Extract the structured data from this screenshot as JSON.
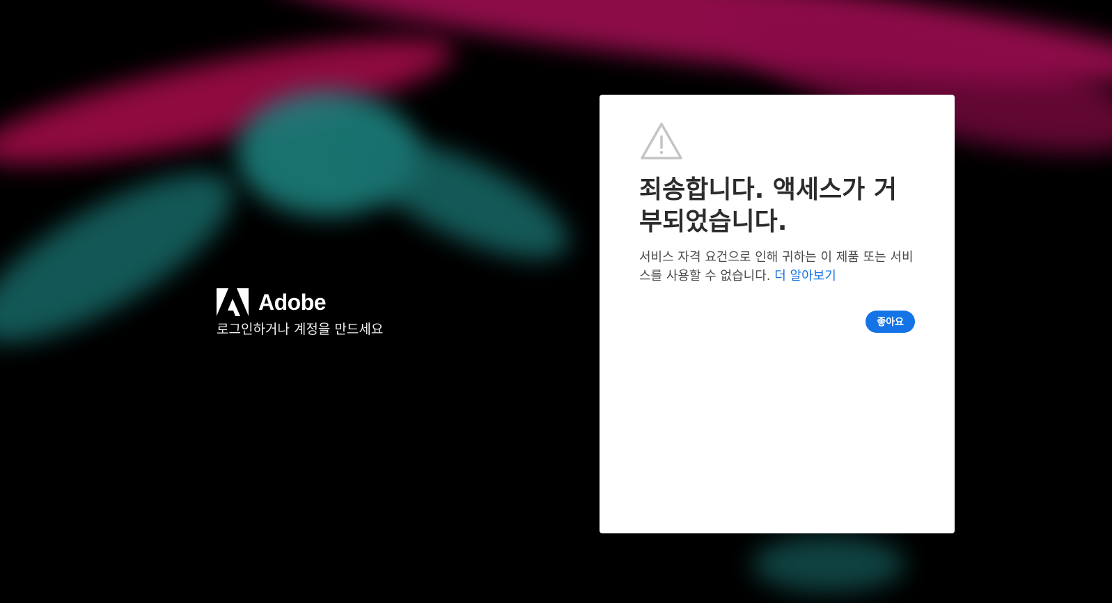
{
  "brand": {
    "name": "Adobe",
    "tagline": "로그인하거나 계정을 만드세요"
  },
  "dialog": {
    "icon": "warning-triangle-icon",
    "title": "죄송합니다. 액세스가 거부되었습니다.",
    "message": "서비스 자격 요건으로 인해 귀하는 이 제품 또는 서비스를 사용할 수 없습니다.",
    "link": "더 알아보기",
    "button": "좋아요"
  },
  "colors": {
    "accent": "#1473e6",
    "magenta": "#b0104f",
    "teal": "#1f8a86"
  }
}
